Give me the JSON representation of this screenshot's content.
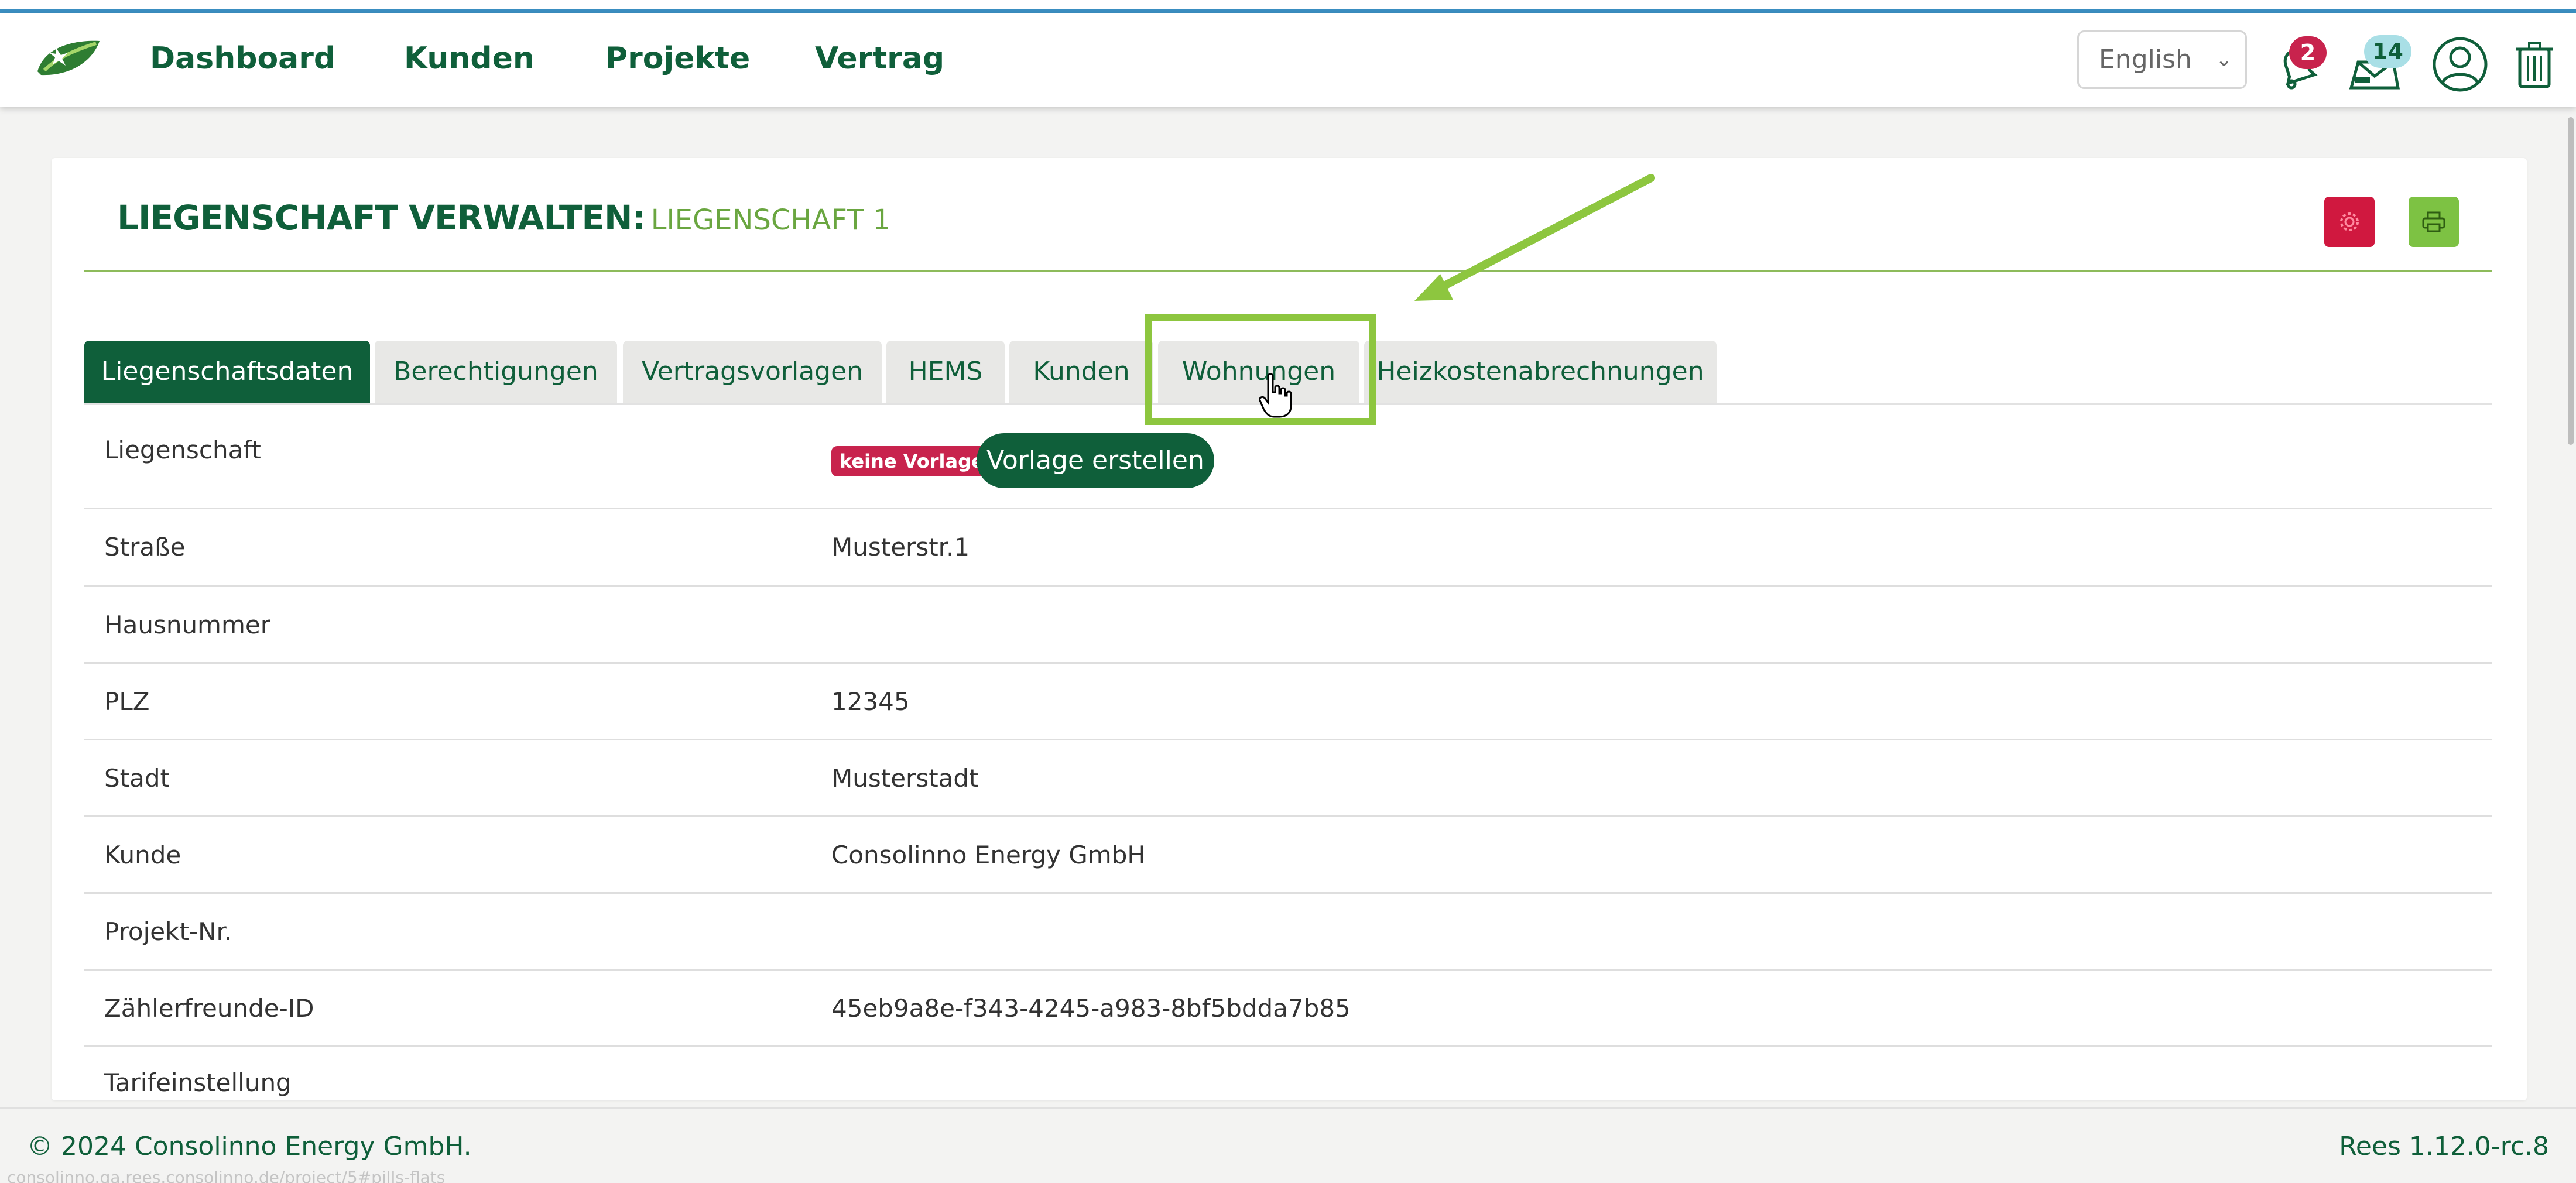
{
  "navbar": {
    "links": [
      "Dashboard",
      "Kunden",
      "Projekte",
      "Vertrag"
    ],
    "language": "English",
    "notifications_count": "2",
    "messages_count": "14",
    "icons": [
      "bell-icon",
      "envelope-icon",
      "user-circle-icon",
      "trash-icon"
    ]
  },
  "page": {
    "title_main": "LIEGENSCHAFT VERWALTEN:",
    "title_sub": "LIEGENSCHAFT 1",
    "settings_icon": "gear-icon",
    "print_icon": "printer-icon"
  },
  "tabs": [
    {
      "label": "Liegenschaftsdaten",
      "active": true
    },
    {
      "label": "Berechtigungen",
      "active": false
    },
    {
      "label": "Vertragsvorlagen",
      "active": false
    },
    {
      "label": "HEMS",
      "active": false
    },
    {
      "label": "Kunden",
      "active": false
    },
    {
      "label": "Wohnungen",
      "active": false
    },
    {
      "label": "Heizkostenabrechnungen",
      "active": false
    }
  ],
  "property": {
    "badge_no_template": "keine Vorlage",
    "create_template_button": "Vorlage erstellen",
    "rows": [
      {
        "label": "Liegenschaft",
        "value": ""
      },
      {
        "label": "Straße",
        "value": "Musterstr.1"
      },
      {
        "label": "Hausnummer",
        "value": ""
      },
      {
        "label": "PLZ",
        "value": "12345"
      },
      {
        "label": "Stadt",
        "value": "Musterstadt"
      },
      {
        "label": "Kunde",
        "value": "Consolinno Energy GmbH"
      },
      {
        "label": "Projekt-Nr.",
        "value": ""
      },
      {
        "label": "Zählerfreunde-ID",
        "value": "45eb9a8e-f343-4245-a983-8bf5bdda7b85"
      },
      {
        "label": "Tarifeinstellung",
        "value": ""
      }
    ]
  },
  "footer": {
    "copyright": "© 2024 Consolinno Energy GmbH.",
    "version": "Rees 1.12.0-rc.8",
    "status_url": "consolinno.qa.rees.consolinno.de/project/5#pills-flats"
  },
  "colors": {
    "brand_green": "#0f5f3a",
    "accent_green": "#8dc63f",
    "danger": "#c8234d"
  }
}
